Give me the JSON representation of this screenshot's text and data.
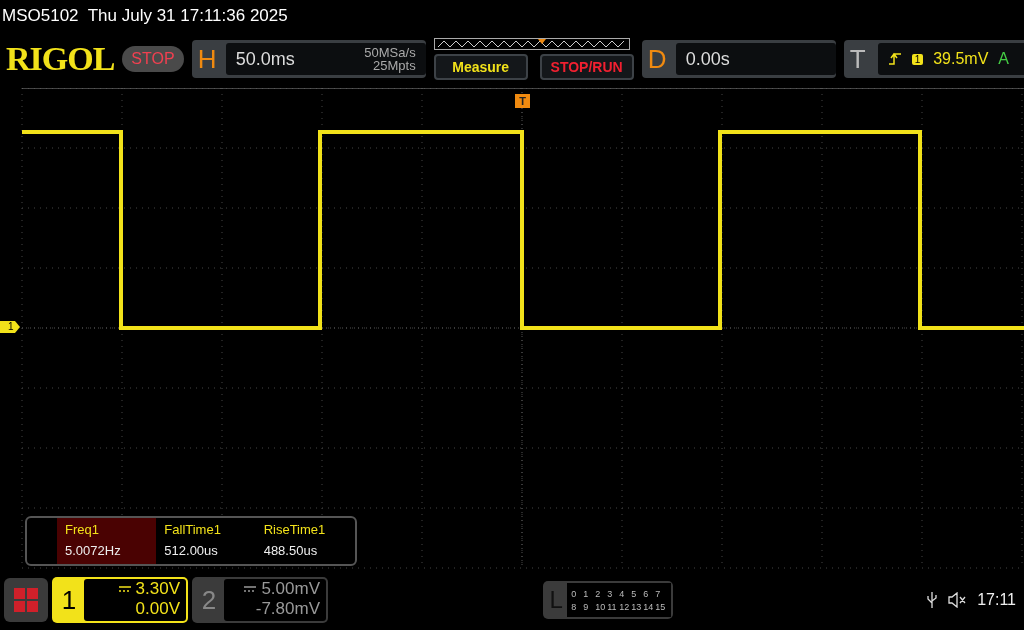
{
  "title_bar": {
    "text": "MSO5102  Thu July 31 17:11:36 2025"
  },
  "top_bar": {
    "brand": "RIGOL",
    "run_state": "STOP",
    "horizontal": {
      "label": "H",
      "timebase": "50.0ms",
      "sample_rate": "50MSa/s",
      "memory_depth": "25Mpts"
    },
    "buttons": [
      {
        "label": "Measure",
        "kind": "measure"
      },
      {
        "label": "STOP/RUN",
        "kind": "stoprun"
      }
    ],
    "delay": {
      "label": "D",
      "value": "0.00s"
    },
    "trigger": {
      "label": "T",
      "source": "1",
      "level": "39.5mV",
      "mode": "A"
    }
  },
  "display": {
    "channel_marker": "1",
    "trigger_marker": "T",
    "measurements": [
      {
        "name": "Freq1",
        "value": "5.0072Hz",
        "selected": true
      },
      {
        "name": "FallTime1",
        "value": "512.00us",
        "selected": false
      },
      {
        "name": "RiseTime1",
        "value": "488.50us",
        "selected": false
      }
    ]
  },
  "bottom_bar": {
    "channels": [
      {
        "number": "1",
        "scale": "3.30V",
        "offset": "0.00V",
        "active": true
      },
      {
        "number": "2",
        "scale": "5.00mV",
        "offset": "-7.80mV",
        "active": false
      }
    ],
    "logic": {
      "label": "L",
      "rows": [
        [
          "0",
          "1",
          "2",
          "3",
          "4",
          "5",
          "6",
          "7"
        ],
        [
          "8",
          "9",
          "10",
          "11",
          "12",
          "13",
          "14",
          "15"
        ]
      ]
    },
    "time": "17:11"
  }
}
